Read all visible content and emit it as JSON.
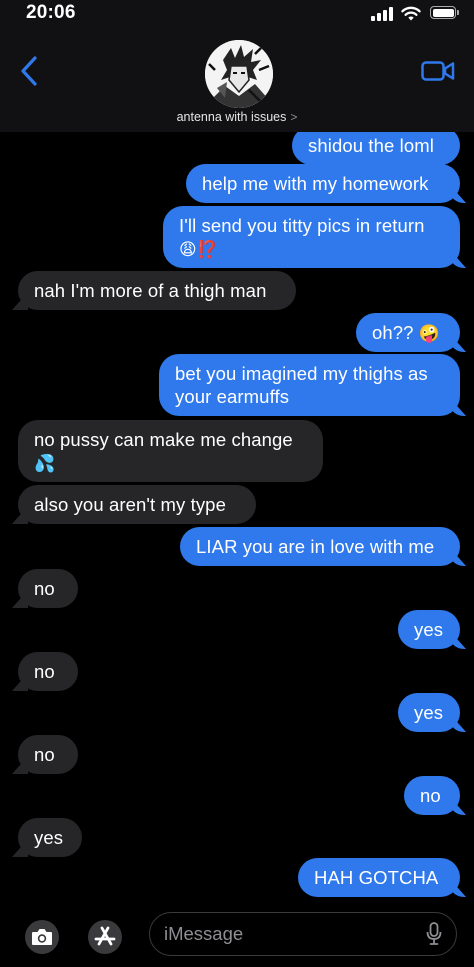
{
  "status_bar": {
    "time": "20:06"
  },
  "header": {
    "contact_name": "antenna with issues",
    "chevron": ">"
  },
  "messages": [
    {
      "side": "out",
      "text": "shidou the loml"
    },
    {
      "side": "out",
      "text": "help me with my homework"
    },
    {
      "side": "out",
      "text": "I'll send you titty pics in return",
      "emoji": "😩⁉️"
    },
    {
      "side": "in",
      "text": "nah I'm more of a thigh man"
    },
    {
      "side": "out",
      "text": "oh??",
      "emoji": "🤪"
    },
    {
      "side": "out",
      "text": "bet you imagined my thighs as\nyour earmuffs"
    },
    {
      "side": "in",
      "text": "no pussy can make me change",
      "emoji": "💦"
    },
    {
      "side": "in",
      "text": "also you aren't my type"
    },
    {
      "side": "out",
      "text": "LIAR you are in love with me"
    },
    {
      "side": "in",
      "text": "no"
    },
    {
      "side": "out",
      "text": "yes"
    },
    {
      "side": "in",
      "text": "no"
    },
    {
      "side": "out",
      "text": "yes"
    },
    {
      "side": "in",
      "text": "no"
    },
    {
      "side": "out",
      "text": "no"
    },
    {
      "side": "in",
      "text": "yes"
    },
    {
      "side": "out",
      "text": "HAH GOTCHA"
    }
  ],
  "composer": {
    "placeholder": "iMessage"
  },
  "colors": {
    "outgoing": "#2f79ec",
    "incoming": "#262628",
    "accent": "#2f79ec"
  },
  "icons": [
    "back-chevron-icon",
    "video-call-icon",
    "camera-icon",
    "app-store-icon",
    "microphone-icon",
    "signal-icon",
    "wifi-icon",
    "battery-icon"
  ]
}
